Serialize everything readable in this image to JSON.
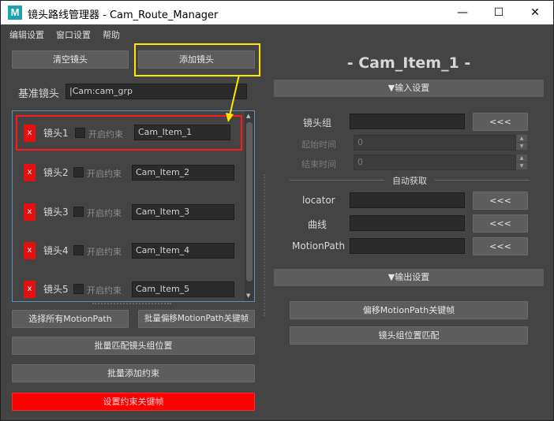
{
  "window": {
    "title": "镜头路线管理器 - Cam_Route_Manager",
    "app_icon": "M",
    "minimize": "—",
    "maximize": "☐",
    "close": "✕"
  },
  "menu": [
    "编辑设置",
    "窗口设置",
    "帮助"
  ],
  "left": {
    "clear_button": "清空镜头",
    "add_button": "添加镜头",
    "base_camera_label": "基准镜头",
    "base_camera_value": "|Cam:cam_grp",
    "remove_label": "x",
    "constraint_label": "开启约束",
    "rows": [
      {
        "label": "镜头1",
        "item": "Cam_Item_1"
      },
      {
        "label": "镜头2",
        "item": "Cam_Item_2"
      },
      {
        "label": "镜头3",
        "item": "Cam_Item_3"
      },
      {
        "label": "镜头4",
        "item": "Cam_Item_4"
      },
      {
        "label": "镜头5",
        "item": "Cam_Item_5"
      }
    ],
    "select_motionpath_button": "选择所有MotionPath",
    "batch_offset_button": "批量偏移MotionPath关键帧",
    "batch_match_button": "批量匹配镜头组位置",
    "batch_constraint_button": "批量添加约束",
    "set_constraint_key_button": "设置约束关键帧"
  },
  "right": {
    "title": "- Cam_Item_1 -",
    "input_header": "▼输入设置",
    "cam_group_label": "镜头组",
    "start_time_label": "起始时间",
    "start_time_value": "0",
    "end_time_label": "结束时间",
    "end_time_value": "0",
    "auto_fetch_label": "自动获取",
    "locator_label": "locator",
    "curve_label": "曲线",
    "motionpath_label": "MotionPath",
    "pick_button": "<<<",
    "spin_up": "▲",
    "spin_down": "▼",
    "output_header": "▼输出设置",
    "offset_key_button": "偏移MotionPath关键帧",
    "match_pos_button": "镜头组位置匹配"
  },
  "colors": {
    "background": "#444444",
    "button": "#5d5d5d",
    "field": "#2b2b2b",
    "remove_red": "#e41010",
    "highlight_red": "#ff0000",
    "annotation_yellow": "#ffe600",
    "selection_border": "#5b8fbf"
  }
}
